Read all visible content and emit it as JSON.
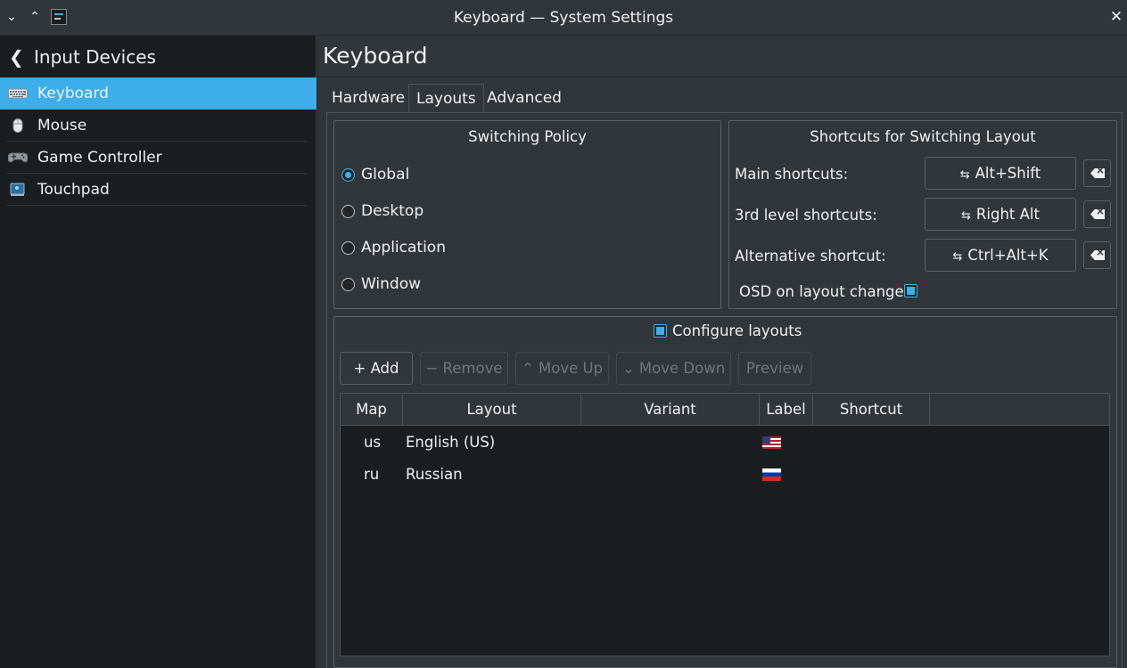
{
  "window": {
    "title": "Keyboard — System Settings"
  },
  "sidebar": {
    "header": "Input Devices",
    "items": [
      {
        "label": "Keyboard",
        "icon": "keyboard-icon",
        "active": true
      },
      {
        "label": "Mouse",
        "icon": "mouse-icon",
        "active": false
      },
      {
        "label": "Game Controller",
        "icon": "gamepad-icon",
        "active": false
      },
      {
        "label": "Touchpad",
        "icon": "touchpad-icon",
        "active": false
      }
    ]
  },
  "main": {
    "title": "Keyboard",
    "tabs": [
      {
        "label": "Hardware",
        "active": false
      },
      {
        "label": "Layouts",
        "active": true
      },
      {
        "label": "Advanced",
        "active": false
      }
    ]
  },
  "switching_policy": {
    "title": "Switching Policy",
    "options": [
      {
        "label": "Global",
        "selected": true
      },
      {
        "label": "Desktop",
        "selected": false
      },
      {
        "label": "Application",
        "selected": false
      },
      {
        "label": "Window",
        "selected": false
      }
    ]
  },
  "shortcuts": {
    "title": "Shortcuts for Switching Layout",
    "rows": [
      {
        "label": "Main shortcuts:",
        "value": "Alt+Shift"
      },
      {
        "label": "3rd level shortcuts:",
        "value": "Right Alt"
      },
      {
        "label": "Alternative shortcut:",
        "value": "Ctrl+Alt+K"
      }
    ],
    "osd_label": "OSD on layout change",
    "osd_checked": true
  },
  "layouts": {
    "configure_label": "Configure layouts",
    "configure_checked": true,
    "buttons": {
      "add": "Add",
      "remove": "Remove",
      "move_up": "Move Up",
      "move_down": "Move Down",
      "preview": "Preview"
    },
    "columns": [
      "Map",
      "Layout",
      "Variant",
      "Label",
      "Shortcut"
    ],
    "rows": [
      {
        "map": "us",
        "layout": "English (US)",
        "variant": "",
        "label_icon": "us-flag-icon",
        "shortcut": ""
      },
      {
        "map": "ru",
        "layout": "Russian",
        "variant": "",
        "label_icon": "ru-flag-icon",
        "shortcut": ""
      }
    ]
  },
  "colors": {
    "accent": "#3daee9",
    "window_bg": "#31363b",
    "sidebar_bg": "#1b1e20",
    "text": "#eff0f1"
  }
}
